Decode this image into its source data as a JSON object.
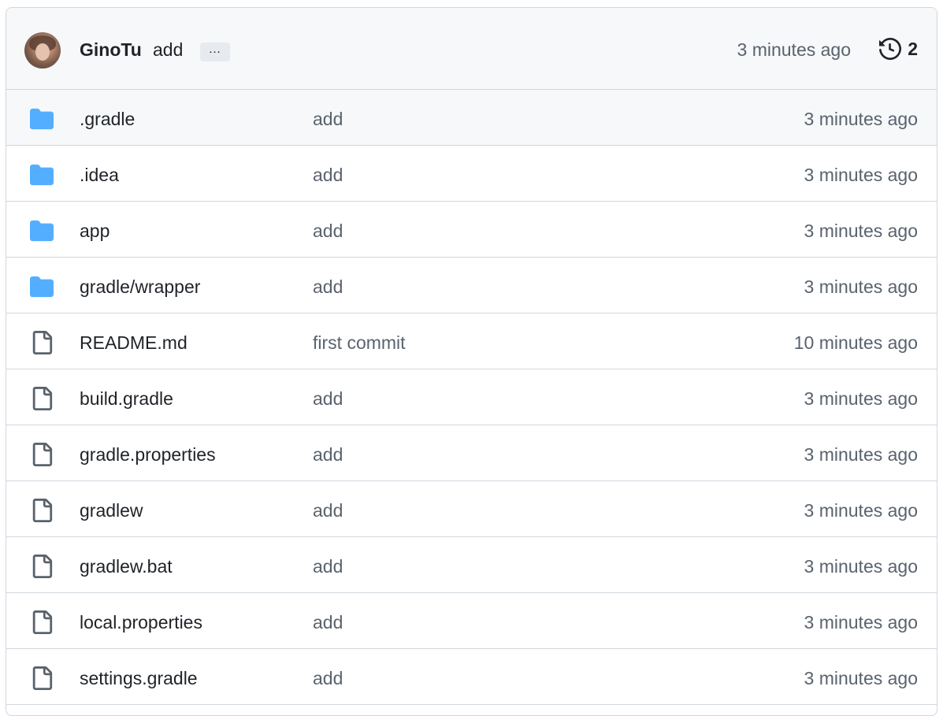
{
  "commit": {
    "author": "GinoTu",
    "message": "add",
    "ellipsis": "…",
    "time": "3 minutes ago",
    "history_count": "2"
  },
  "colors": {
    "folder": "#54aeff",
    "file_icon": "#59636e",
    "border": "#d0d7de",
    "header_bg": "#f6f8fa"
  },
  "files": [
    {
      "type": "folder",
      "icon": "folder-icon",
      "name": ".gradle",
      "message": "add",
      "time": "3 minutes ago"
    },
    {
      "type": "folder",
      "icon": "folder-icon",
      "name": ".idea",
      "message": "add",
      "time": "3 minutes ago"
    },
    {
      "type": "folder",
      "icon": "folder-icon",
      "name": "app",
      "message": "add",
      "time": "3 minutes ago"
    },
    {
      "type": "folder",
      "icon": "folder-icon",
      "name": "gradle/wrapper",
      "message": "add",
      "time": "3 minutes ago"
    },
    {
      "type": "file",
      "icon": "file-icon",
      "name": "README.md",
      "message": "first commit",
      "time": "10 minutes ago"
    },
    {
      "type": "file",
      "icon": "file-icon",
      "name": "build.gradle",
      "message": "add",
      "time": "3 minutes ago"
    },
    {
      "type": "file",
      "icon": "file-icon",
      "name": "gradle.properties",
      "message": "add",
      "time": "3 minutes ago"
    },
    {
      "type": "file",
      "icon": "file-icon",
      "name": "gradlew",
      "message": "add",
      "time": "3 minutes ago"
    },
    {
      "type": "file",
      "icon": "file-icon",
      "name": "gradlew.bat",
      "message": "add",
      "time": "3 minutes ago"
    },
    {
      "type": "file",
      "icon": "file-icon",
      "name": "local.properties",
      "message": "add",
      "time": "3 minutes ago"
    },
    {
      "type": "file",
      "icon": "file-icon",
      "name": "settings.gradle",
      "message": "add",
      "time": "3 minutes ago"
    }
  ]
}
